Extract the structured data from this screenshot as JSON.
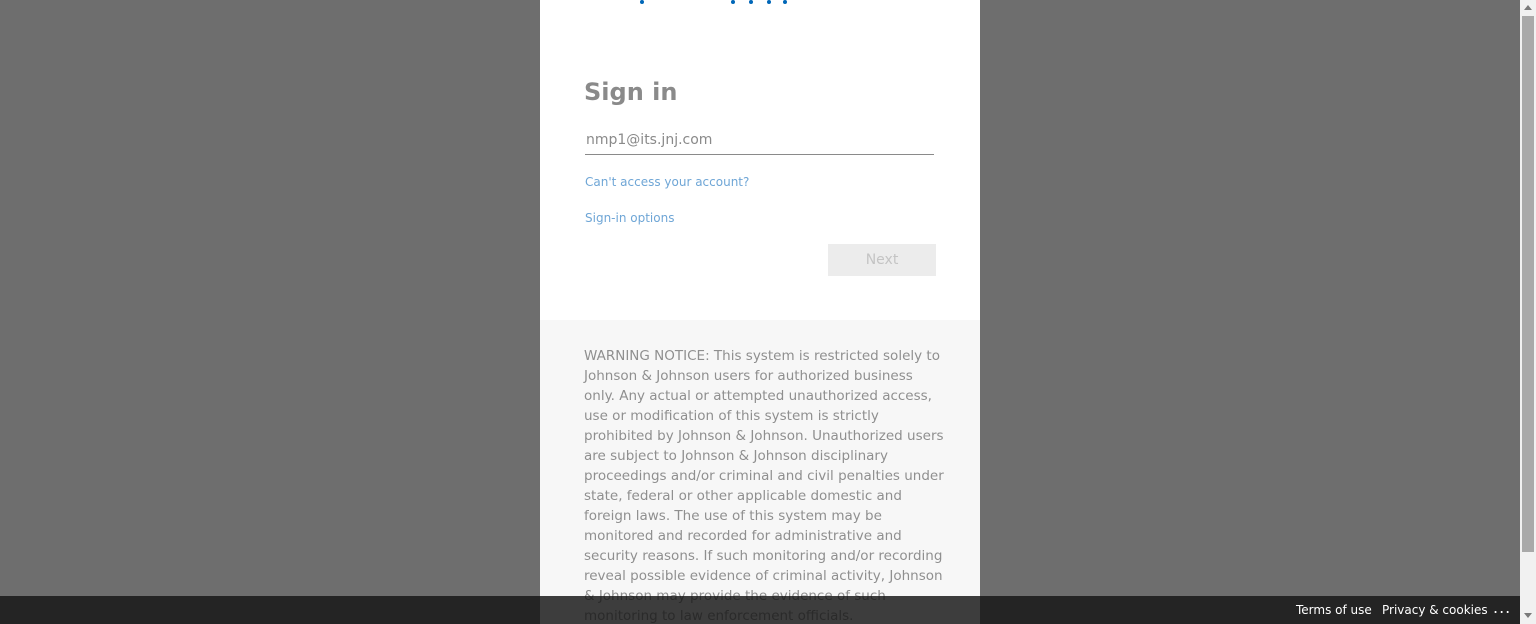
{
  "signin": {
    "title": "Sign in",
    "email_value": "nmp1@its.jnj.com",
    "cant_access_label": "Can't access your account?",
    "signin_options_label": "Sign-in options",
    "next_label": "Next"
  },
  "notice": {
    "text": "WARNING NOTICE: This system is restricted solely to Johnson & Johnson users for authorized business only. Any actual or attempted unauthorized access, use or modification of this system is strictly prohibited by Johnson & Johnson. Unauthorized users are subject to Johnson & Johnson disciplinary proceedings and/or criminal and civil penalties under state, federal or other applicable domestic and foreign laws. The use of this system may be monitored and recorded for administrative and security reasons. If such monitoring and/or recording reveal possible evidence of criminal activity, Johnson & Johnson may provide the evidence of such monitoring to law enforcement officials."
  },
  "footer": {
    "terms_label": "Terms of use",
    "privacy_label": "Privacy & cookies",
    "more_label": "..."
  },
  "colors": {
    "accent": "#0067b8",
    "link": "#6fa6d6",
    "overlay": "#6e6e6e"
  },
  "icons": {
    "loading": "loading-dots-icon",
    "more": "ellipsis-icon"
  }
}
